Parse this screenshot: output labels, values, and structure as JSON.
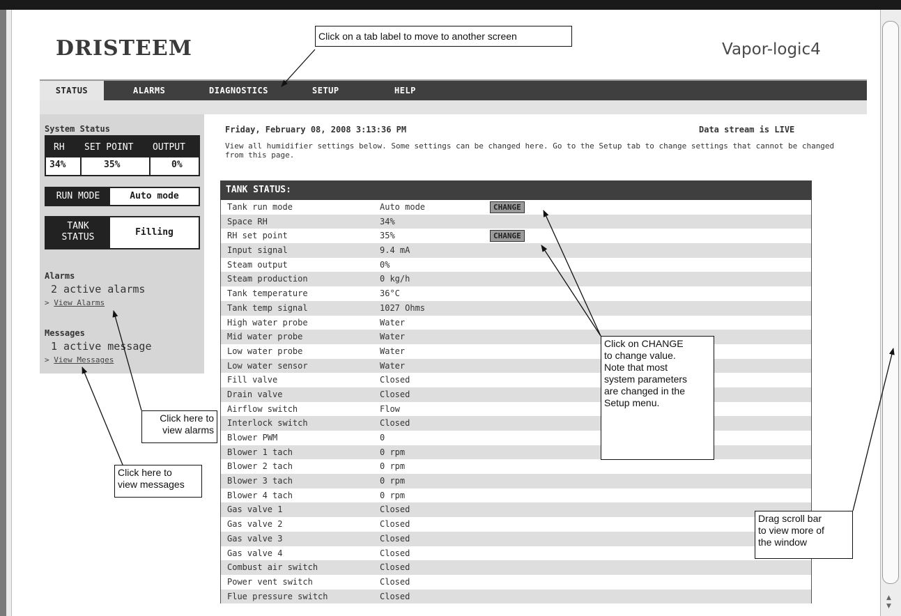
{
  "header": {
    "logo": "DRISTEEM",
    "logo_mark": "·",
    "product": "Vapor-logic4"
  },
  "tabs": [
    {
      "label": "STATUS"
    },
    {
      "label": "ALARMS"
    },
    {
      "label": "DIAGNOSTICS"
    },
    {
      "label": "SETUP"
    },
    {
      "label": "HELP"
    }
  ],
  "sidebar": {
    "system_status_title": "System Status",
    "columns": [
      "RH",
      "SET POINT",
      "OUTPUT"
    ],
    "values": [
      "34%",
      "35%",
      "0%"
    ],
    "run_mode_label": "RUN MODE",
    "run_mode_value": "Auto mode",
    "tank_status_label_1": "TANK",
    "tank_status_label_2": "STATUS",
    "tank_status_value": "Filling",
    "alarms_title": "Alarms",
    "alarms_count": "2 active alarms",
    "view_alarms_prefix": ">",
    "view_alarms": "View Alarms",
    "messages_title": "Messages",
    "messages_count": "1 active message",
    "view_messages_prefix": ">",
    "view_messages": "View Messages"
  },
  "main": {
    "datetime": "Friday, February 08, 2008 3:13:36 PM",
    "stream_status": "Data stream is LIVE",
    "intro": "View all humidifier settings below. Some settings can be changed here. Go to the Setup tab to change settings that cannot be changed from this page.",
    "tank_status_title": "TANK STATUS:",
    "change_label": "CHANGE",
    "rows": [
      {
        "param": "Tank run mode",
        "value": "Auto mode",
        "change": true
      },
      {
        "param": "Space RH",
        "value": "34%",
        "change": false
      },
      {
        "param": "RH set point",
        "value": "35%",
        "change": true
      },
      {
        "param": "Input signal",
        "value": "9.4 mA",
        "change": false
      },
      {
        "param": "Steam output",
        "value": "0%",
        "change": false
      },
      {
        "param": "Steam production",
        "value": "0 kg/h",
        "change": false
      },
      {
        "param": "Tank temperature",
        "value": "36°C",
        "change": false
      },
      {
        "param": "Tank temp signal",
        "value": "1027 Ohms",
        "change": false
      },
      {
        "param": "High water probe",
        "value": "Water",
        "change": false
      },
      {
        "param": "Mid water probe",
        "value": "Water",
        "change": false
      },
      {
        "param": "Low water probe",
        "value": "Water",
        "change": false
      },
      {
        "param": "Low water sensor",
        "value": "Water",
        "change": false
      },
      {
        "param": "Fill valve",
        "value": "Closed",
        "change": false
      },
      {
        "param": "Drain valve",
        "value": "Closed",
        "change": false
      },
      {
        "param": "Airflow switch",
        "value": "Flow",
        "change": false
      },
      {
        "param": "Interlock switch",
        "value": "Closed",
        "change": false
      },
      {
        "param": "Blower PWM",
        "value": "0",
        "change": false
      },
      {
        "param": "Blower 1 tach",
        "value": "0 rpm",
        "change": false
      },
      {
        "param": "Blower 2 tach",
        "value": "0 rpm",
        "change": false
      },
      {
        "param": "Blower 3 tach",
        "value": "0 rpm",
        "change": false
      },
      {
        "param": "Blower 4 tach",
        "value": "0 rpm",
        "change": false
      },
      {
        "param": "Gas valve 1",
        "value": "Closed",
        "change": false
      },
      {
        "param": "Gas valve 2",
        "value": "Closed",
        "change": false
      },
      {
        "param": "Gas valve 3",
        "value": "Closed",
        "change": false
      },
      {
        "param": "Gas valve 4",
        "value": "Closed",
        "change": false
      },
      {
        "param": "Combust air switch",
        "value": "Closed",
        "change": false
      },
      {
        "param": "Power vent switch",
        "value": "Closed",
        "change": false
      },
      {
        "param": "Flue pressure switch",
        "value": "Closed",
        "change": false
      }
    ]
  },
  "callouts": {
    "tabs": "Click on a tab label to move to another screen",
    "alarms_1": "Click here to",
    "alarms_2": "view alarms",
    "messages_1": "Click here to",
    "messages_2": "view messages",
    "change_1": "Click on CHANGE",
    "change_2": "to change value.",
    "change_3": "Note that most",
    "change_4": "system parameters",
    "change_5": "are changed in the",
    "change_6": "Setup menu.",
    "scroll_1": "Drag scroll bar",
    "scroll_2": "to view more of",
    "scroll_3": "the window"
  },
  "scrollbar": {
    "up_icon": "▲",
    "down_icon": "▼"
  }
}
